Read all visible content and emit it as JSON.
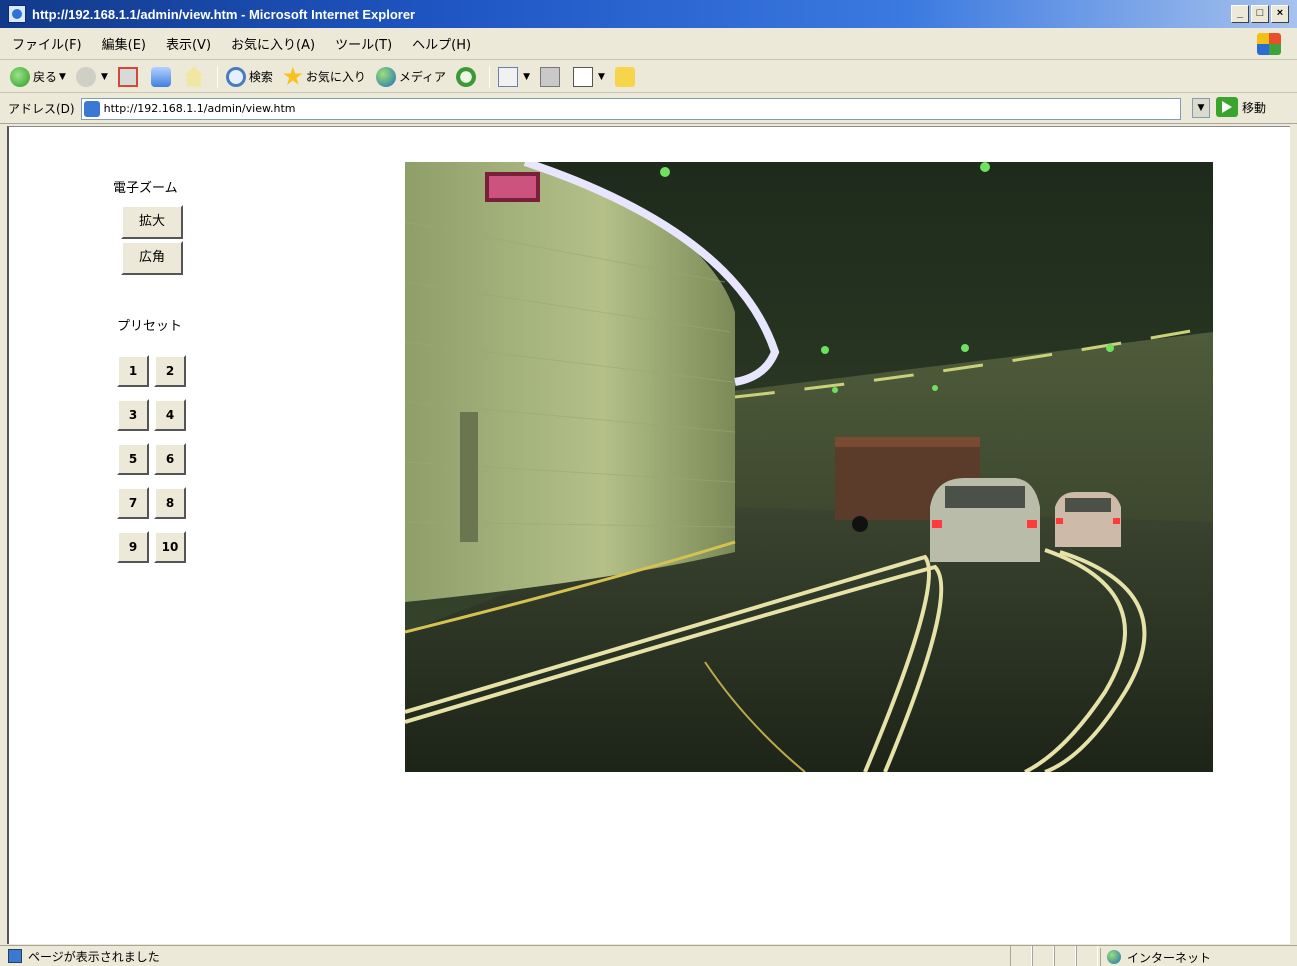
{
  "window": {
    "title": "http://192.168.1.1/admin/view.htm - Microsoft Internet Explorer",
    "controls": [
      "_",
      "□",
      "×"
    ]
  },
  "menu": [
    "ファイル(F)",
    "編集(E)",
    "表示(V)",
    "お気に入り(A)",
    "ツール(T)",
    "ヘルプ(H)"
  ],
  "toolbar": {
    "back_label": "戻る",
    "search_label": "検索",
    "favorites_label": "お気に入り",
    "media_label": "メディア"
  },
  "address": {
    "label": "アドレス(D)",
    "url": "http://192.168.1.1/admin/view.htm",
    "go_label": "移動"
  },
  "page": {
    "zoom_label": "電子ズーム",
    "zoom_in": "拡大",
    "zoom_out": "広角",
    "preset_label": "プリセット",
    "presets": [
      "1",
      "2",
      "3",
      "4",
      "5",
      "6",
      "7",
      "8",
      "9",
      "10"
    ]
  },
  "status": {
    "text": "ページが表示されました",
    "zone": "インターネット"
  },
  "colors": {
    "titlebar": "#1f56c4",
    "chrome": "#ece9d8"
  }
}
